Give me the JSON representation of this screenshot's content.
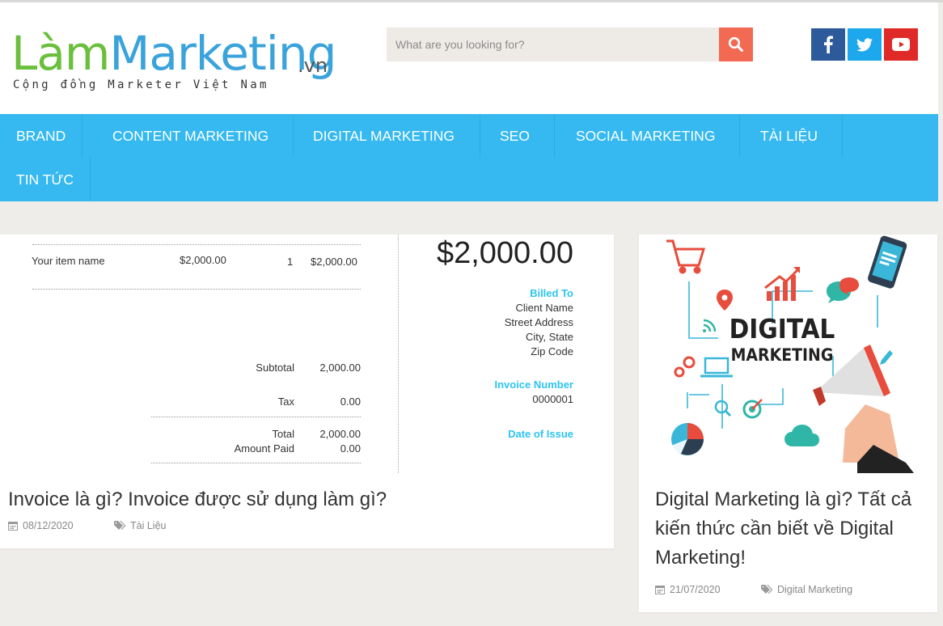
{
  "logo": {
    "lam": "Làm",
    "marketing": "Marketing",
    "vn": ".vn",
    "tagline": "Cộng đồng Marketer Việt Nam"
  },
  "search": {
    "placeholder": "What are you looking for?"
  },
  "social": [
    "facebook-icon",
    "twitter-icon",
    "youtube-icon"
  ],
  "colors": {
    "nav": "#35b9f0",
    "search_button": "#f26a52",
    "facebook": "#2d5a9b",
    "twitter": "#1da7ec",
    "youtube": "#e02a28"
  },
  "nav": {
    "items": [
      "BRAND",
      "CONTENT MARKETING",
      "DIGITAL MARKETING",
      "SEO",
      "SOCIAL MARKETING",
      "TÀI LIỆU",
      "TIN TỨC"
    ]
  },
  "invoice_image": {
    "item_name": "Your item name",
    "item_price": "$2,000.00",
    "item_qty": "1",
    "item_total": "$2,000.00",
    "big_amount": "$2,000.00",
    "billed_to_label": "Billed To",
    "client_name": "Client Name",
    "street": "Street Address",
    "city": "City, State",
    "zip": "Zip Code",
    "invoice_number_label": "Invoice Number",
    "invoice_number": "0000001",
    "date_label": "Date of Issue",
    "subtotal_label": "Subtotal",
    "subtotal_value": "2,000.00",
    "tax_label": "Tax",
    "tax_value": "0.00",
    "total_label": "Total",
    "total_value": "2,000.00",
    "paid_label": "Amount Paid",
    "paid_value": "0.00"
  },
  "dm_image": {
    "line1": "DIGITAL",
    "line2": "MARKETING"
  },
  "posts": [
    {
      "title": "Invoice là gì? Invoice được sử dụng làm gì?",
      "date": "08/12/2020",
      "category": "Tài Liệu"
    },
    {
      "title": "Digital Marketing là gì? Tất cả kiến thức cần biết về Digital Marketing!",
      "date": "21/07/2020",
      "category": "Digital Marketing"
    }
  ]
}
